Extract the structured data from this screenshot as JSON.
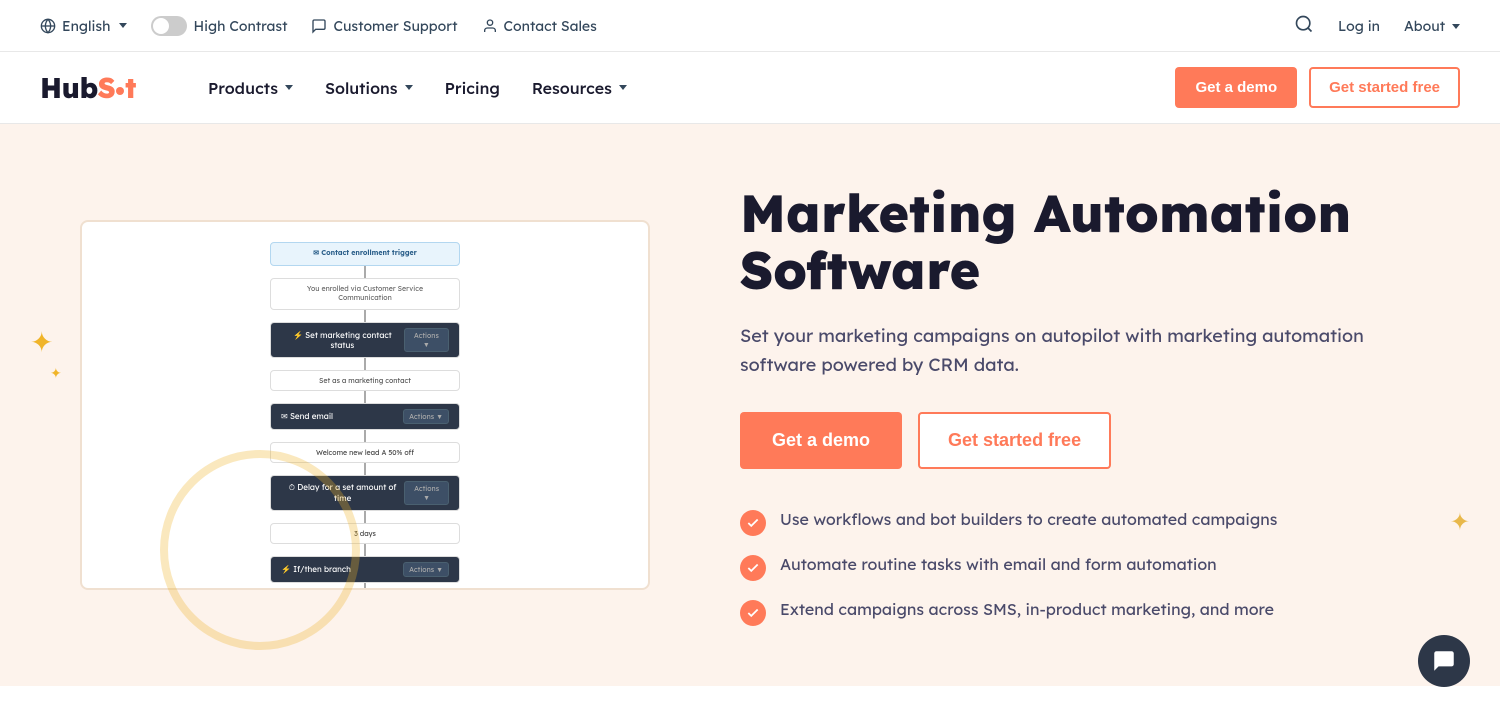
{
  "topbar": {
    "language": {
      "label": "English",
      "icon": "globe-icon"
    },
    "contrast": {
      "label": "High Contrast",
      "icon": "contrast-icon"
    },
    "support": {
      "label": "Customer Support",
      "icon": "chat-icon"
    },
    "sales": {
      "label": "Contact Sales",
      "icon": "person-icon"
    },
    "search_icon": "search-icon",
    "login": "Log in",
    "about": "About"
  },
  "nav": {
    "logo": {
      "text_before_dot": "Hub",
      "dot": "Sp",
      "text_after_dot": "t"
    },
    "items": [
      {
        "label": "Products",
        "has_dropdown": true
      },
      {
        "label": "Solutions",
        "has_dropdown": true
      },
      {
        "label": "Pricing",
        "has_dropdown": false
      },
      {
        "label": "Resources",
        "has_dropdown": true
      }
    ],
    "cta_demo": "Get a demo",
    "cta_started": "Get started free"
  },
  "hero": {
    "title": "Marketing Automation Software",
    "description": "Set your marketing campaigns on autopilot with marketing automation software powered by CRM data.",
    "cta_demo": "Get a demo",
    "cta_started": "Get started free",
    "features": [
      "Use workflows and bot builders to create automated campaigns",
      "Automate routine tasks with email and form automation",
      "Extend campaigns across SMS, in-product marketing, and more"
    ]
  }
}
